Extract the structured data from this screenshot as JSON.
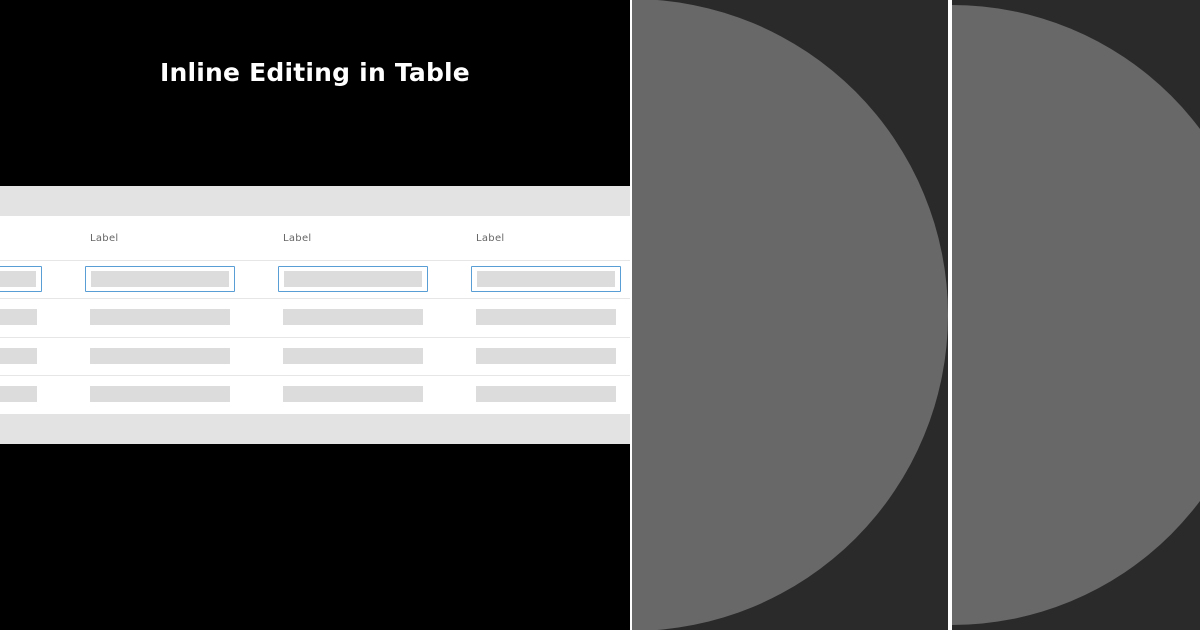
{
  "title": "Inline Editing in Table",
  "table": {
    "columns": [
      {
        "label": ""
      },
      {
        "label": "Label"
      },
      {
        "label": "Label"
      },
      {
        "label": "Label"
      }
    ],
    "editing_row": 1,
    "placeholder_rows": 3
  },
  "colors": {
    "background": "#000000",
    "table_band": "#e3e3e3",
    "table_body": "#ffffff",
    "placeholder_fill": "#dcdcdc",
    "edit_border": "#5a9ed6",
    "panel_dark": "#2a2a2a",
    "circle": "#686868"
  }
}
